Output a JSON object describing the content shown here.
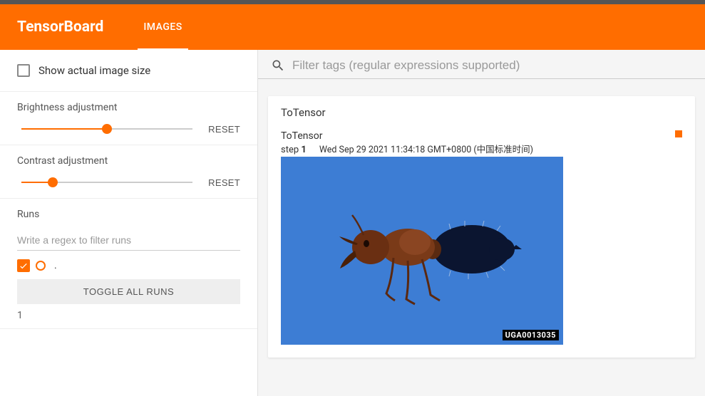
{
  "header": {
    "logo": "TensorBoard",
    "tab": "IMAGES"
  },
  "sidebar": {
    "show_actual_label": "Show actual image size",
    "brightness": {
      "label": "Brightness adjustment",
      "reset": "RESET",
      "pct": 50
    },
    "contrast": {
      "label": "Contrast adjustment",
      "reset": "RESET",
      "pct": 20
    },
    "runs": {
      "label": "Runs",
      "placeholder": "Write a regex to filter runs",
      "run_name": ".",
      "toggle_all": "TOGGLE ALL RUNS",
      "page": "1"
    }
  },
  "main": {
    "search_placeholder": "Filter tags (regular expressions supported)",
    "card": {
      "title": "ToTensor",
      "image": {
        "tag": "ToTensor",
        "step_label": "step",
        "step": "1",
        "timestamp": "Wed Sep 29 2021 11:34:18 GMT+0800 (中国标准时间)",
        "watermark": "UGA0013035"
      }
    }
  }
}
